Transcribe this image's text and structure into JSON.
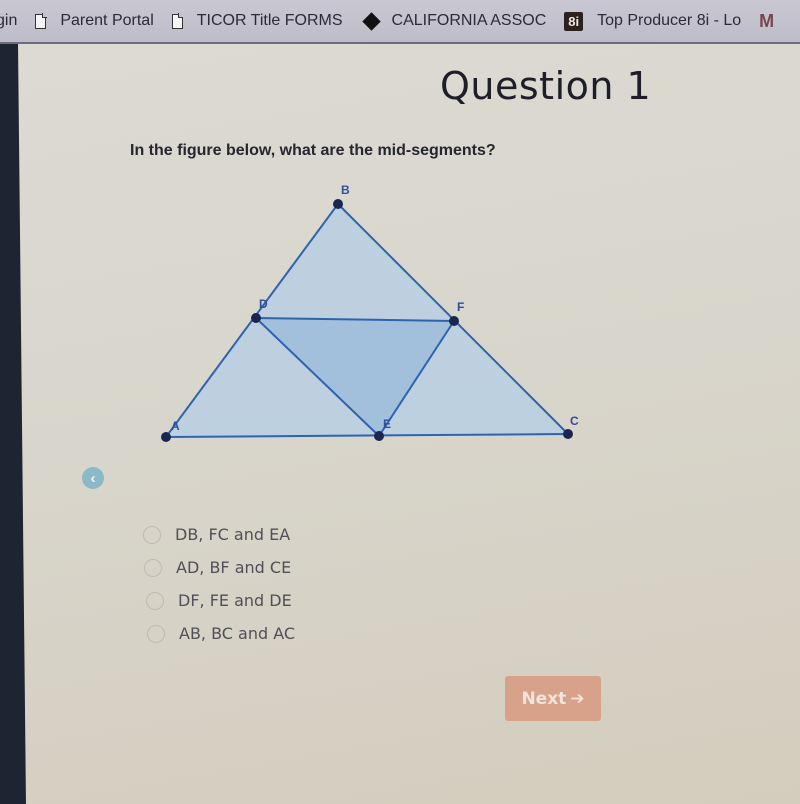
{
  "bookmarks": [
    {
      "label": "gin",
      "icon": "none"
    },
    {
      "label": "Parent Portal",
      "icon": "doc-icon"
    },
    {
      "label": "TICOR Title FORMS",
      "icon": "doc-icon"
    },
    {
      "label": "CALIFORNIA ASSOC",
      "icon": "diamond-icon"
    },
    {
      "label": "Top Producer 8i - Lo",
      "icon": "badge-8i",
      "badge": "8i"
    },
    {
      "label": "M",
      "icon": "m-icon"
    }
  ],
  "question": {
    "title": "Question 1",
    "text": "In the figure below, what are the mid-segments?"
  },
  "figure": {
    "fill_outer": "#b9cfe3",
    "fill_inner": "#9fbedc",
    "stroke": "#2e63b0",
    "point_color": "#1a2550",
    "points": {
      "B": {
        "label": "B"
      },
      "D": {
        "label": "D"
      },
      "F": {
        "label": "F"
      },
      "A": {
        "label": "A"
      },
      "E": {
        "label": "E"
      },
      "C": {
        "label": "C"
      }
    }
  },
  "back_button": {
    "icon": "chevron-left-icon",
    "glyph": "‹"
  },
  "options": [
    {
      "label": "DB, FC and EA",
      "selected": false
    },
    {
      "label": "AD, BF and CE",
      "selected": false
    },
    {
      "label": "DF, FE and DE",
      "selected": false
    },
    {
      "label": "AB, BC and AC",
      "selected": false
    }
  ],
  "next_button": {
    "label": "Next",
    "arrow": "➔"
  }
}
